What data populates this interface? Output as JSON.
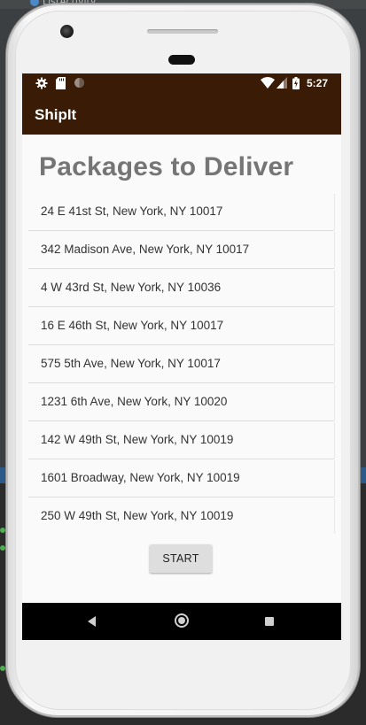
{
  "ide": {
    "tab_title": "ListActivity"
  },
  "status_bar": {
    "time": "5:27",
    "icons": [
      "gear-icon",
      "sd-card-icon",
      "sync-circle-icon",
      "wifi-icon",
      "signal-icon",
      "battery-charging-icon"
    ]
  },
  "app_bar": {
    "title": "ShipIt"
  },
  "main": {
    "heading": "Packages to Deliver",
    "packages": [
      "24 E 41st St, New York, NY 10017",
      "342 Madison Ave, New York, NY 10017",
      "4 W 43rd St, New York, NY 10036",
      "16 E 46th St, New York, NY 10017",
      "575 5th Ave, New York, NY 10017",
      "1231 6th Ave, New York, NY 10020",
      "142 W 49th St, New York, NY 10019",
      "1601 Broadway, New York, NY 10019",
      "250 W 49th St, New York, NY 10019"
    ],
    "start_label": "START"
  },
  "nav_bar": {
    "icons": [
      "back-icon",
      "home-icon",
      "recent-apps-icon"
    ]
  },
  "colors": {
    "app_bar": "#3a1c06",
    "heading": "#757575",
    "button": "#dedede"
  }
}
